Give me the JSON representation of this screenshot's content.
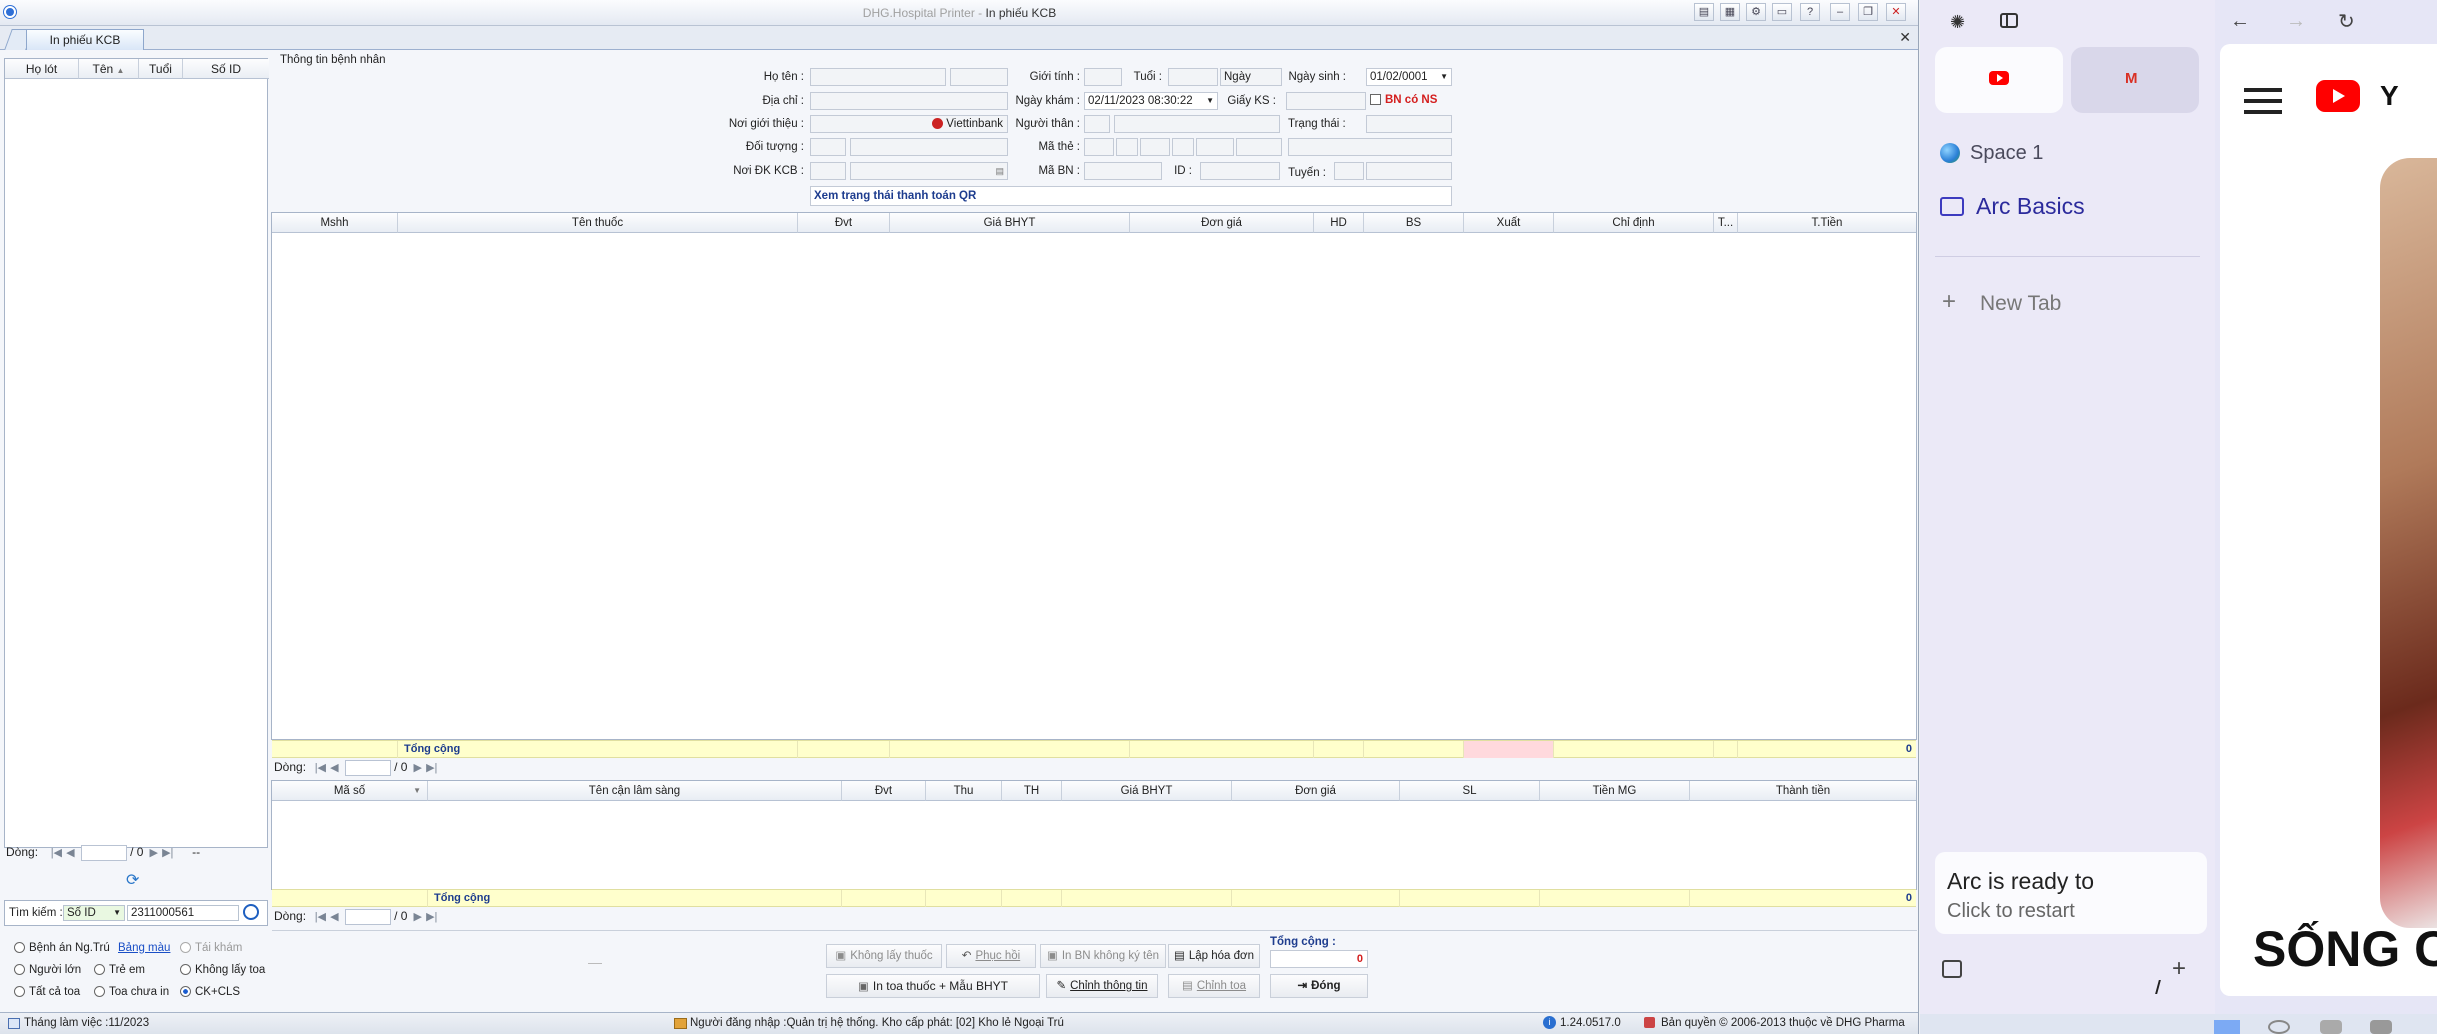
{
  "window": {
    "title_prefix": "DHG.Hospital Printer - ",
    "title": "In phiếu KCB",
    "buttons": [
      "▤",
      "▦",
      "⚙",
      "▭",
      "?",
      "–",
      "❐",
      "✕"
    ]
  },
  "tab": {
    "label": "In phiếu KCB",
    "close": "✕"
  },
  "patient_list": {
    "columns": [
      "Họ lót",
      "Tên",
      "Tuổi",
      "Số ID"
    ],
    "sort_arrow": "▲",
    "nav_label": "Dòng:",
    "page_value": "",
    "page_total": "/ 0",
    "nav_extra": "--"
  },
  "refresh_icon": "⟳",
  "search": {
    "label": "Tìm kiếm :",
    "field": "Số ID",
    "value": "2311000561"
  },
  "filters": {
    "benh_an": "Bệnh án Ng.Trú",
    "bang_mau": "Bảng màu",
    "tai_kham": "Tái khám",
    "nguoi_lon": "Người lớn",
    "tre_em": "Trẻ em",
    "khong_lay_toa": "Không lấy toa",
    "tat_ca_toa": "Tất cả toa",
    "toa_chua_in": "Toa chưa in",
    "ck_cls": "CK+CLS"
  },
  "patient_info": {
    "section_title": "Thông tin bệnh nhân",
    "ho_ten": "Họ tên :",
    "dia_chi": "Địa chỉ :",
    "noi_gioi_thieu": "Nơi giới thiệu :",
    "doi_tuong": "Đối tượng :",
    "noi_dk_kcb": "Nơi ĐK KCB :",
    "gioi_tinh": "Giới tính :",
    "tuoi": "Tuổi :",
    "tuoi_unit": "Ngày",
    "ngay_sinh": "Ngày sinh :",
    "ngay_sinh_value": "01/02/0001",
    "ngay_kham": "Ngày khám :",
    "ngay_kham_value": "02/11/2023 08:30:22",
    "giay_ks": "Giấy KS :",
    "bn_co_ns": "BN có NS",
    "nguoi_than": "Người thân :",
    "trang_thai": "Trạng thái :",
    "ma_the": "Mã thẻ :",
    "ma_bn": "Mã BN :",
    "id": "ID :",
    "tuyen": "Tuyến :",
    "bank": "Viettinbank",
    "qr_link": "Xem trạng thái thanh toán QR"
  },
  "drug_grid": {
    "columns": [
      "Mshh",
      "Tên thuốc",
      "Đvt",
      "Giá BHYT",
      "Đơn giá",
      "HD",
      "BS",
      "Xuất",
      "Chỉ định",
      "T...",
      "T.Tiền"
    ],
    "total_label": "Tổng cộng",
    "total_value": "0",
    "nav_label": "Dòng:",
    "page_total": "/ 0"
  },
  "cls_grid": {
    "columns": [
      "Mã số",
      "Tên cận lâm sàng",
      "Đvt",
      "Thu",
      "TH",
      "Giá BHYT",
      "Đơn giá",
      "SL",
      "Tiền MG",
      "Thành tiền"
    ],
    "total_label": "Tổng cộng",
    "total_value": "0",
    "nav_label": "Dòng:",
    "page_total": "/ 0"
  },
  "actions": {
    "khong_lay_thuoc": "Không lấy thuốc",
    "phuc_hoi": "Phục hồi",
    "in_bn": "In BN không ký tên",
    "lap_hoa_don": "Lập hóa đơn",
    "in_toa": "In toa thuốc + Mẫu BHYT",
    "chinh_thong_tin": "Chỉnh thông tin",
    "chinh_toa": "Chỉnh toa",
    "dong": "Đóng",
    "tong_cong_label": "Tổng cộng :",
    "tong_cong_value": "0"
  },
  "statusbar": {
    "thang": "Tháng làm việc :11/2023",
    "user": "Người đăng nhập :Quản trị hệ thống. Kho cấp phát: [02] Kho lẻ Ngoại Trú",
    "version": "1.24.0517.0",
    "copyright": "Bản quyền © 2006-2013 thuộc về DHG Pharma"
  },
  "arc": {
    "space": "Space 1",
    "folder": "Arc Basics",
    "new_tab": "New Tab",
    "toast_title": "Arc is ready to",
    "toast_sub": "Click to restart",
    "page_text": "SỐNG C"
  }
}
